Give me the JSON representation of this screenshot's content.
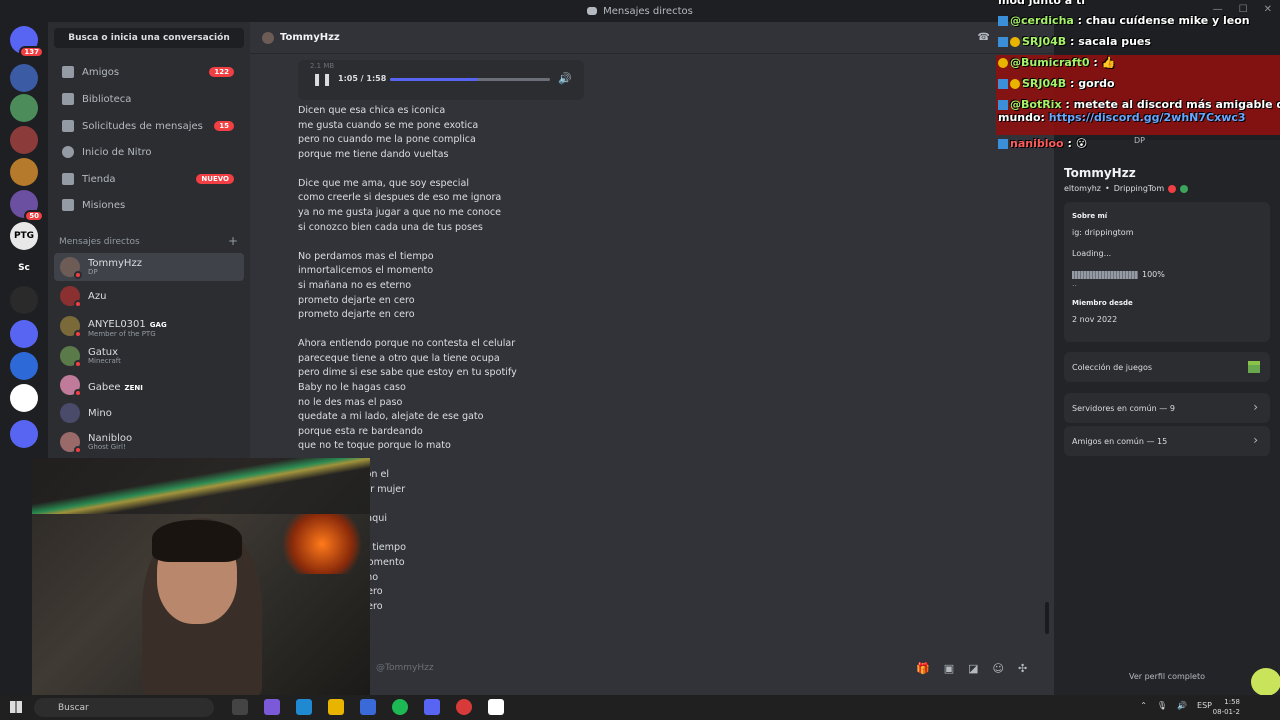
{
  "window": {
    "title": "Mensajes directos"
  },
  "servers": [
    {
      "name": "discord-home",
      "badge": "137",
      "color": "#5865f2"
    },
    {
      "name": "server-2",
      "color": "#3b5ba5"
    },
    {
      "name": "server-3",
      "color": "#4b8c5a"
    },
    {
      "name": "server-4",
      "color": "#8c3b3b"
    },
    {
      "name": "server-5",
      "color": "#b57a2c"
    },
    {
      "name": "server-6",
      "badge": "50",
      "color": "#6b4fa0"
    },
    {
      "name": "server-ptg",
      "label": "PTG",
      "color": "#e8e8e8"
    },
    {
      "name": "server-sc",
      "label": "Sc",
      "color": "#1e1f22"
    },
    {
      "name": "server-9",
      "color": "#2a2a2a"
    },
    {
      "name": "server-10",
      "color": "#5865f2"
    },
    {
      "name": "server-11",
      "color": "#2d6ad8"
    },
    {
      "name": "server-12",
      "color": "#ffffff"
    },
    {
      "name": "server-13",
      "color": "#5865f2"
    }
  ],
  "sidebar": {
    "search_label": "Busca o inicia una conversación",
    "nav": [
      {
        "label": "Amigos",
        "badge": "122"
      },
      {
        "label": "Biblioteca"
      },
      {
        "label": "Solicitudes de mensajes",
        "badge": "15"
      },
      {
        "label": "Inicio de Nitro"
      },
      {
        "label": "Tienda",
        "badge": "NUEVO"
      },
      {
        "label": "Misiones"
      }
    ],
    "dm_header": "Mensajes directos",
    "dms": [
      {
        "name": "TommyHzz",
        "sub": "DP",
        "color": "#6d5c56"
      },
      {
        "name": "Azu",
        "sub": "",
        "color": "#8a3030"
      },
      {
        "name": "ANYEL0301",
        "tag": "GAG",
        "sub": "Member of the PTG",
        "color": "#7a6a3a"
      },
      {
        "name": "Gatux",
        "sub": "Minecraft",
        "color": "#5a7a4a"
      },
      {
        "name": "Gabee",
        "tag": "ZENI",
        "sub": "",
        "color": "#c07a9a"
      },
      {
        "name": "Mino",
        "sub": "",
        "color": "#4a4a6a"
      },
      {
        "name": "Nanibloo",
        "sub": "Ghost Girl!",
        "color": "#9a6a6a"
      }
    ]
  },
  "chat": {
    "header_name": "TommyHzz",
    "audio": {
      "size": "2.1 MB",
      "time": "1:05 / 1:58",
      "progress": 0.55
    },
    "verses": [
      [
        "Dicen que esa chica es iconica",
        "me gusta cuando se me pone exotica",
        "pero no cuando me la pone complica",
        "porque me tiene dando vueltas"
      ],
      [
        "Dice que me ama, que soy especial",
        "como creerle si despues de eso me ignora",
        "ya no me gusta jugar a que no me conoce",
        "si conozco bien cada una de tus poses"
      ],
      [
        "No perdamos mas el tiempo",
        "inmortalicemos el momento",
        "si mañana no es eterno",
        "prometo dejarte en cero",
        "prometo dejarte en cero"
      ],
      [
        "Ahora entiendo porque no contesta el celular",
        "pareceque tiene a otro que la tiene ocupa",
        "pero dime si ese sabe que estoy en tu spotify",
        "Baby no le hagas caso",
        "no le des mas el paso",
        "quedate a mi lado, alejate de ese gato",
        "porque esta re bardeando",
        "que no te toque porque lo mato"
      ],
      [
        "                liz con el",
        "                sentir mujer",
        "                mi",
        "                ntir aqui"
      ],
      [
        "                as el tiempo",
        "                el momento",
        "                eterno",
        "                en cero",
        "                en cero"
      ]
    ],
    "input_placeholder": "@TommyHzz"
  },
  "profile": {
    "dp": "DP",
    "display_name": "TommyHzz",
    "username": "eltomyhz",
    "tag": "DrippingTom",
    "about_label": "Sobre mí",
    "about_text": "ig: drippingtom",
    "loading_text": "Loading...",
    "loading_percent": "100%",
    "loading_progress": 1.0,
    "member_label": "Miembro desde",
    "member_date": "2 nov 2022",
    "games_label": "Colección de juegos",
    "servers_label": "Servidores en común — 9",
    "friends_label": "Amigos en común — 15",
    "view_full": "Ver perfil completo"
  },
  "stream_chat": [
    {
      "user": "",
      "text": "mod junto a ti"
    },
    {
      "user": "@cerdicha",
      "text": ": chau cuídense mike y leon"
    },
    {
      "user": "SRJ04B",
      "text": ": sacala pues",
      "badges": true
    },
    {
      "user": "@Bumicraft0",
      "text": ": 👍",
      "gold": true
    },
    {
      "user": "SRJ04B",
      "text": ": gordo",
      "badges": true
    },
    {
      "user": "@BotRix",
      "text": ": metete al discord más amigable del",
      "link_line": "mundo: ",
      "link": "https://discord.gg/2whN7Cxwc3"
    },
    {
      "user": "nanibloo",
      "text": ": 😮",
      "red": true
    }
  ],
  "taskbar": {
    "search": "Buscar",
    "lang": "ESP",
    "time": "1:58",
    "date": "08-01-2"
  }
}
